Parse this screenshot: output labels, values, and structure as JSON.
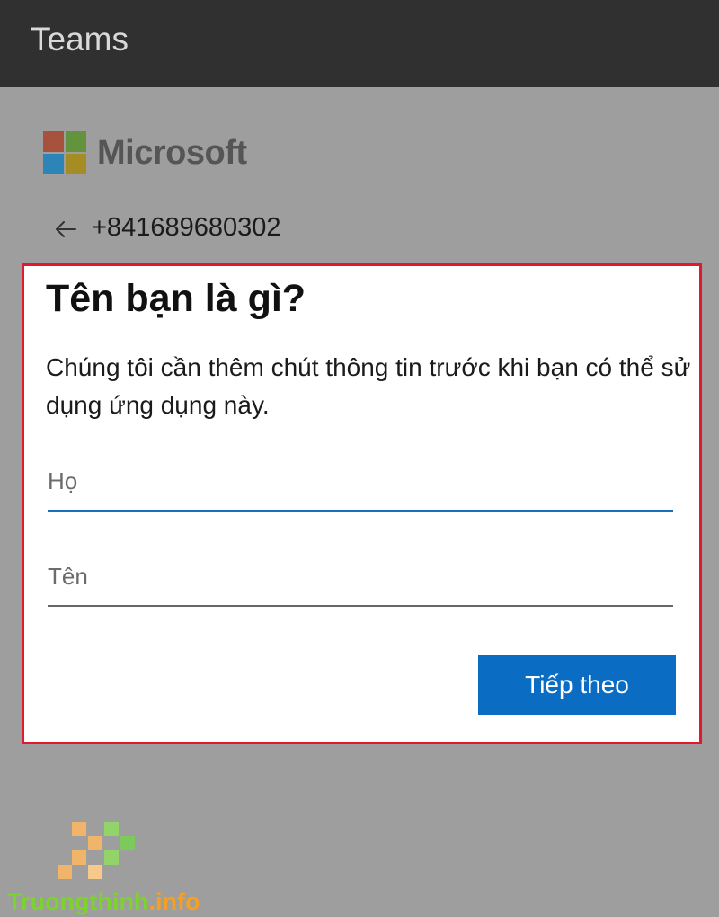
{
  "appbar": {
    "title": "Teams"
  },
  "brand": {
    "name": "Microsoft"
  },
  "account": {
    "phone": "+841689680302"
  },
  "form": {
    "title": "Tên bạn là gì?",
    "description": "Chúng tôi cần thêm chút thông tin trước khi bạn có thể sử dụng ứng dụng này.",
    "last_name": {
      "placeholder": "Họ",
      "value": ""
    },
    "first_name": {
      "placeholder": "Tên",
      "value": ""
    },
    "next_label": "Tiếp theo"
  },
  "watermark": {
    "part1": "Truongthinh",
    "part2": ".info"
  },
  "icons": {
    "back": "arrow-left-icon"
  },
  "colors": {
    "highlight_border": "#e0192f",
    "primary_button": "#0b6cc4",
    "focused_underline": "#1a6fbf",
    "appbar": "#303030",
    "overlay": "#9e9e9e"
  }
}
